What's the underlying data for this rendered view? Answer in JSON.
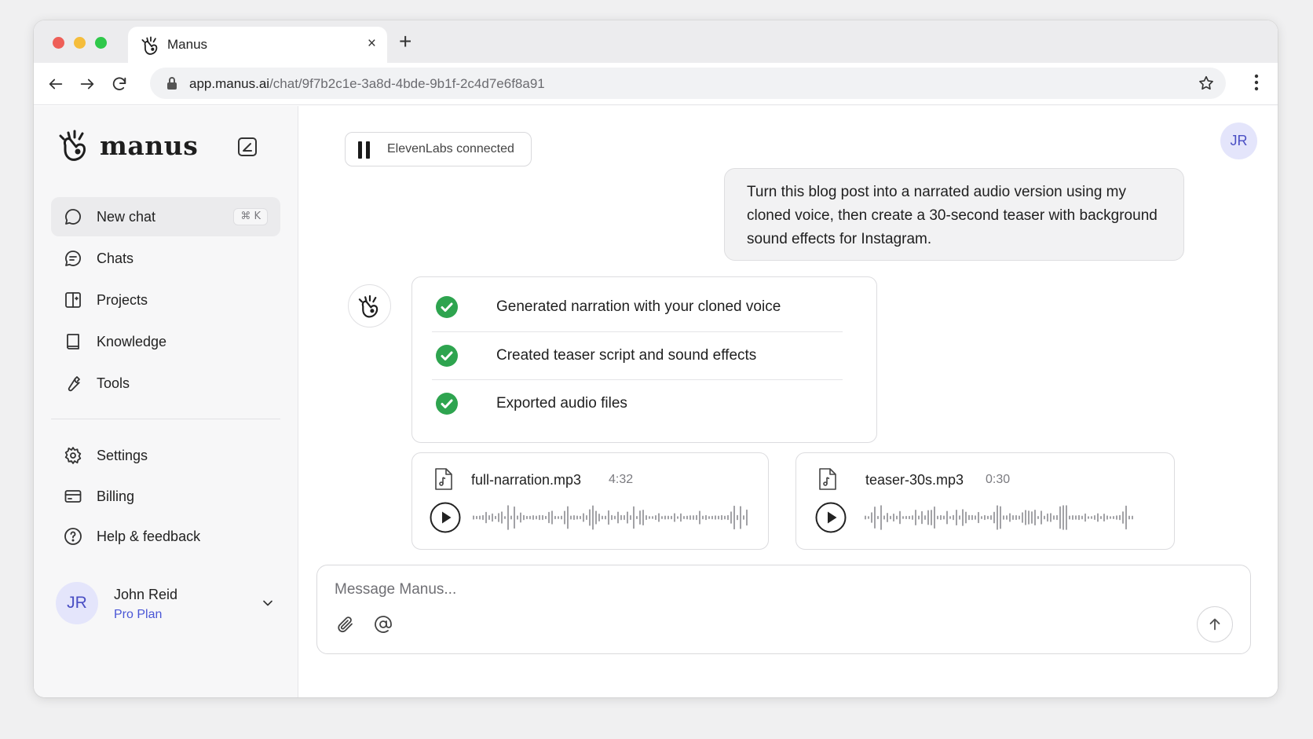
{
  "browser": {
    "tab_title": "Manus",
    "tab_close": "×",
    "new_tab": "+",
    "url_host": "app.manus.ai",
    "url_path": "/chat/9f7b2c1e-3a8d-4bde-9b1f-2c4d7e6f8a91"
  },
  "sidebar": {
    "brand": "manus",
    "items": [
      {
        "label": "New chat",
        "shortcut": "⌘  K",
        "icon": "chat-bubble-icon"
      },
      {
        "label": "Chats",
        "icon": "chats-icon"
      },
      {
        "label": "Projects",
        "icon": "projects-icon"
      },
      {
        "label": "Knowledge",
        "icon": "book-icon"
      },
      {
        "label": "Tools",
        "icon": "wrench-icon"
      }
    ],
    "bottom_items": [
      {
        "label": "Settings",
        "icon": "gear-icon"
      },
      {
        "label": "Billing",
        "icon": "card-icon"
      },
      {
        "label": "Help & feedback",
        "icon": "help-icon"
      }
    ],
    "user": {
      "initials": "JR",
      "name": "John Reid",
      "plan": "Pro Plan"
    }
  },
  "main": {
    "integration_status": "ElevenLabs connected",
    "avatar_initials": "JR",
    "user_message": "Turn this blog post into a narrated audio version using my cloned voice, then create a 30-second teaser with background sound effects for Instagram.",
    "tasks": [
      "Generated narration with your cloned voice",
      "Created teaser script and sound effects",
      "Exported audio files"
    ],
    "audio_files": [
      {
        "name": "full-narration.mp3",
        "duration": "4:32"
      },
      {
        "name": "teaser-30s.mp3",
        "duration": "0:30"
      }
    ],
    "composer": {
      "placeholder": "Message Manus..."
    }
  },
  "colors": {
    "accent": "#4a56d6",
    "success": "#2ea44f",
    "avatar_bg": "#e4e5fb"
  }
}
